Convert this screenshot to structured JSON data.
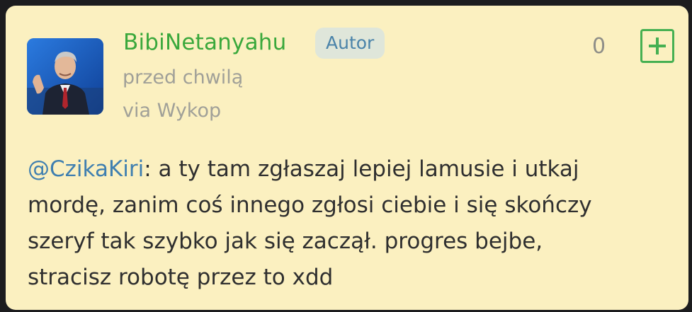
{
  "post": {
    "author": "BibiNetanyahu",
    "badge": "Autor",
    "time": "przed chwilą",
    "source": "via Wykop",
    "vote_count": "0",
    "plus_label": "+",
    "mention": "@CzikaKiri",
    "line1_rest": ": a ty tam zgłaszaj lepiej lamusie i utkaj",
    "line2": "mordę, zanim coś innego zgłosi ciebie i się skończy",
    "line3": "szeryf tak szybko jak się zaczął. progres bejbe,",
    "line4": "stracisz robotę przez to xdd"
  },
  "colors": {
    "card_background": "#fbf0c0",
    "username": "#3aa83c",
    "badge_text": "#4a83a9",
    "mention": "#3f7fb0",
    "plus_accent": "#46b052"
  },
  "icons": {
    "avatar": "user-avatar-photo",
    "plus": "plus-icon"
  }
}
